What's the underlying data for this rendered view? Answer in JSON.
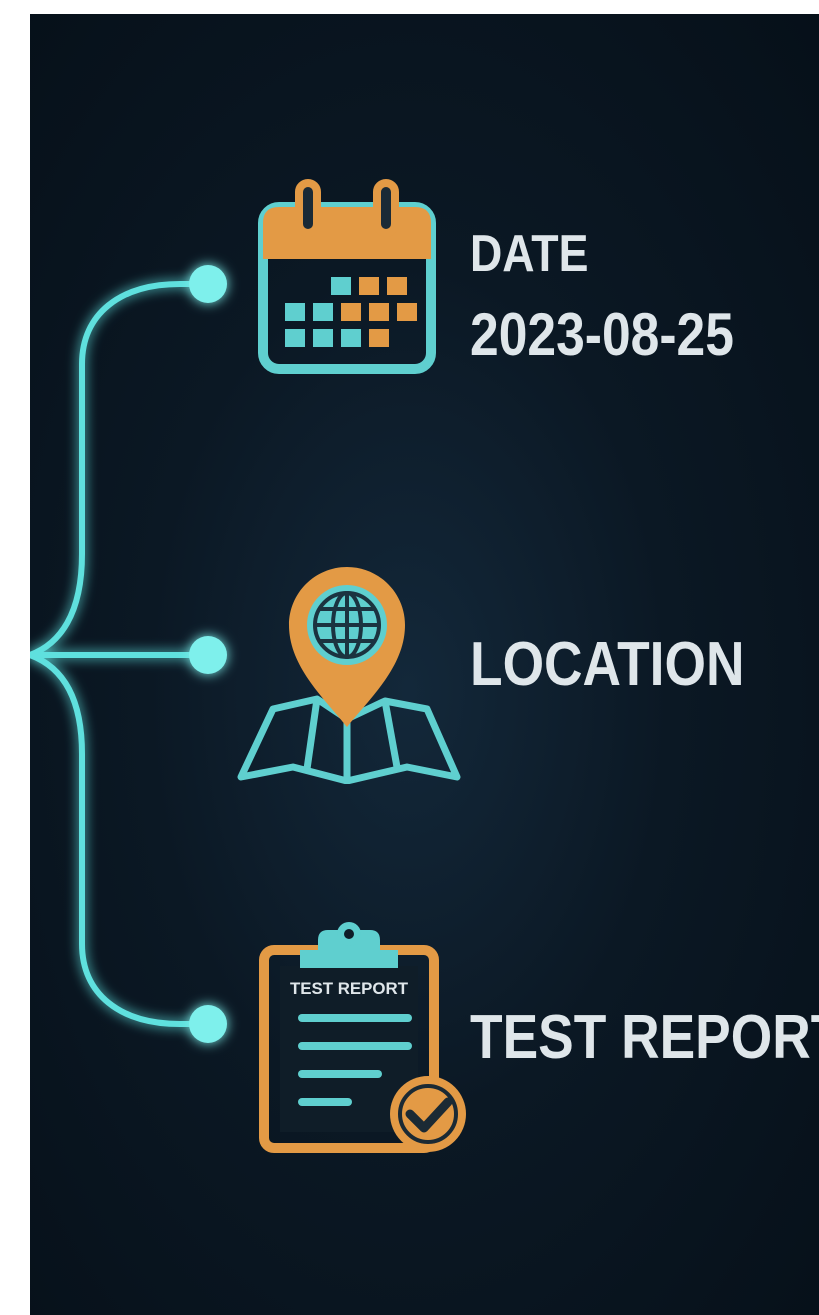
{
  "items": [
    {
      "title": "DATE",
      "value": "2023-08-25",
      "icon": "calendar-icon"
    },
    {
      "title": "LOCATION",
      "icon": "location-pin-map-icon"
    },
    {
      "title": "TEST REPORT",
      "icon": "clipboard-report-icon",
      "icon_text": "TEST REPORT"
    }
  ],
  "colors": {
    "background": "#0b1824",
    "connector": "#5ee0de",
    "icon_orange": "#e39a45",
    "icon_teal": "#5fcfcf",
    "text": "#dfe6ea"
  }
}
